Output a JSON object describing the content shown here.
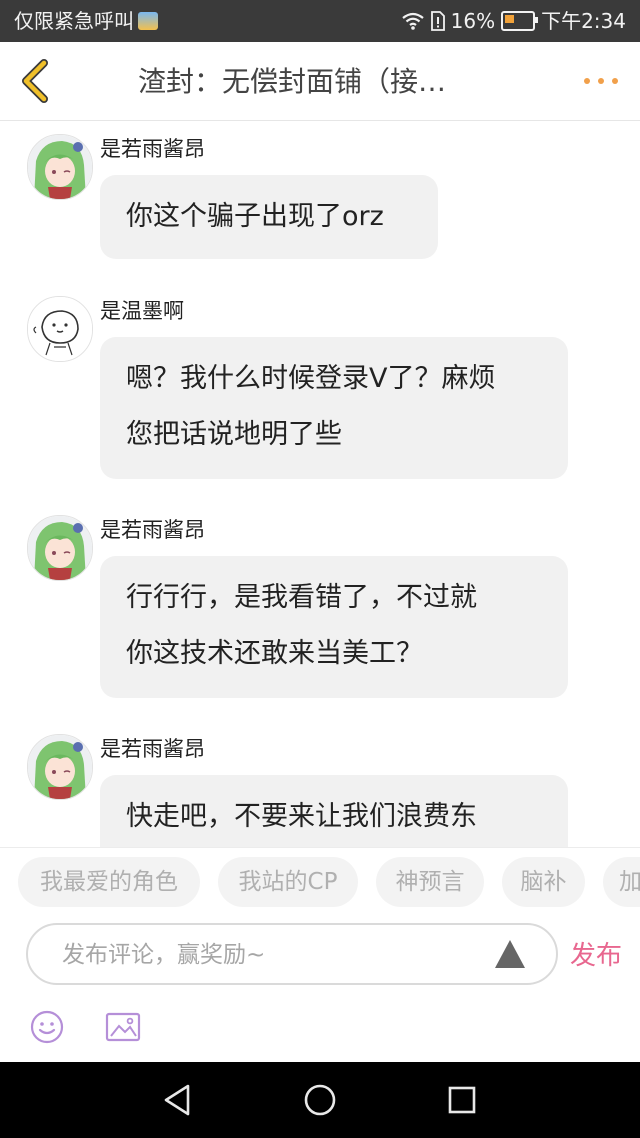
{
  "status_bar": {
    "carrier_text": "仅限紧急呼叫",
    "battery": "16%",
    "battery_level": 0.16,
    "time": "下午2:34"
  },
  "header": {
    "title": "渣封：无偿封面铺（接…"
  },
  "messages": [
    {
      "user": "是若雨酱昂",
      "avatar": "anime-girl-avatar",
      "lines": [
        "你这个骗子出现了orz"
      ]
    },
    {
      "user": "是温墨啊",
      "avatar": "doodle-face-avatar",
      "lines": [
        "嗯？我什么时候登录V了？麻烦",
        "您把话说地明了些"
      ]
    },
    {
      "user": "是若雨酱昂",
      "avatar": "anime-girl-avatar",
      "lines": [
        "行行行，是我看错了，不过就",
        "你这技术还敢来当美工？"
      ]
    },
    {
      "user": "是若雨酱昂",
      "avatar": "anime-girl-avatar",
      "lines": [
        "快走吧，不要来让我们浪费东"
      ]
    }
  ],
  "tags": [
    "我最爱的角色",
    "我站的CP",
    "神预言",
    "脑补",
    "加"
  ],
  "comment": {
    "placeholder": "发布评论，赢奖励~",
    "publish_label": "发布"
  },
  "colors": {
    "accent_pink": "#e8678f",
    "back_arrow": "#f0c02a",
    "more_dots": "#f1a04a",
    "icon_purple": "#b58fd8"
  }
}
